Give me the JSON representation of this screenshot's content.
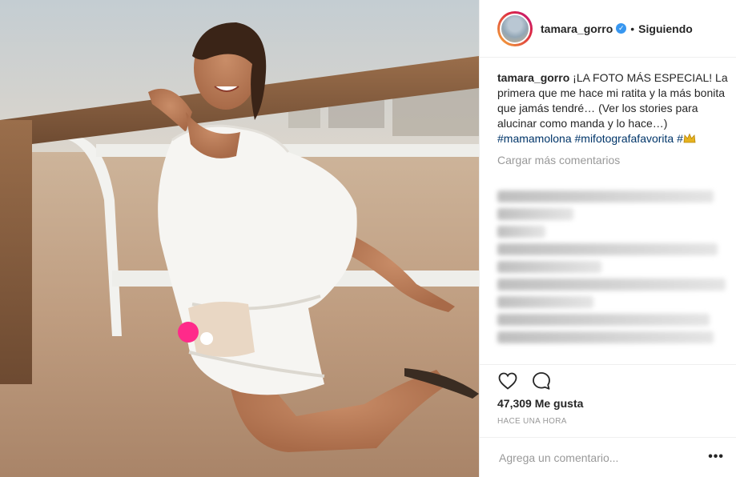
{
  "post": {
    "username": "tamara_gorro",
    "verified": true,
    "follow_status": "Siguiendo",
    "separator": "•"
  },
  "caption": {
    "username": "tamara_gorro",
    "text": "¡LA FOTO MÁS ESPECIAL! La primera que me hace mi ratita y la más bonita que jamás tendré… (Ver los stories para alucinar como manda y lo hace…)",
    "hashtags": "#mamamolona #mifotografafavorita #"
  },
  "load_more": "Cargar más comentarios",
  "likes": "47,309 Me gusta",
  "timestamp": "HACE UNA HORA",
  "comment_box": {
    "placeholder": "Agrega un comentario..."
  },
  "more_options": "•••",
  "icons": {
    "like": "heart-icon",
    "comment": "comment-bubble-icon",
    "verified": "verified-badge-icon",
    "crown": "crown-emoji-icon",
    "more": "more-options-icon"
  },
  "colors": {
    "verified_blue": "#3897f0",
    "hashtag": "#003569",
    "muted": "#999999",
    "text": "#262626"
  }
}
